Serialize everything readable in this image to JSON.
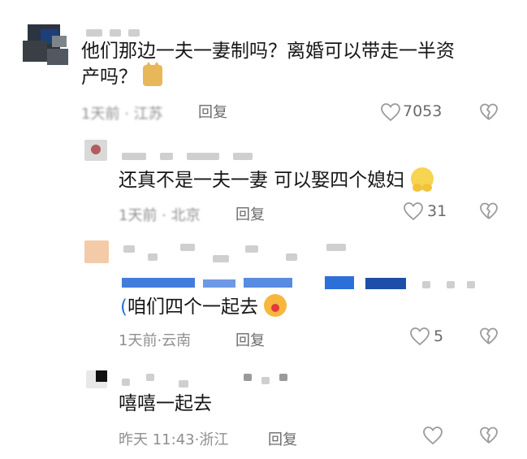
{
  "comments": [
    {
      "text_line1": "他们那边一夫一妻制吗？离婚可以带走一半资",
      "text_line2": "产吗？",
      "meta_time": "1天前",
      "meta_location": "江苏",
      "reply_label": "回复",
      "likes": "7053"
    },
    {
      "text": "还真不是一夫一妻 可以娶四个媳妇",
      "meta_time": "1天前",
      "meta_location": "北京",
      "reply_label": "回复",
      "likes": "31"
    },
    {
      "quote_prefix": "(",
      "text": "咱们四个一起去",
      "meta_time": "1天前",
      "meta_location": "云南",
      "reply_label": "回复",
      "likes": "5"
    },
    {
      "text": "嘻嘻一起去",
      "meta_time": "昨天 11:43",
      "meta_location": "浙江",
      "reply_label": "回复",
      "likes": ""
    }
  ],
  "separator": "·",
  "colors": {
    "text": "#161616",
    "meta": "#8f8f8f",
    "icon": "#9b9b9b",
    "mention_blue": "#2d6fd8"
  },
  "icons": {
    "like": "heart-outline-icon",
    "dislike": "broken-heart-icon"
  }
}
